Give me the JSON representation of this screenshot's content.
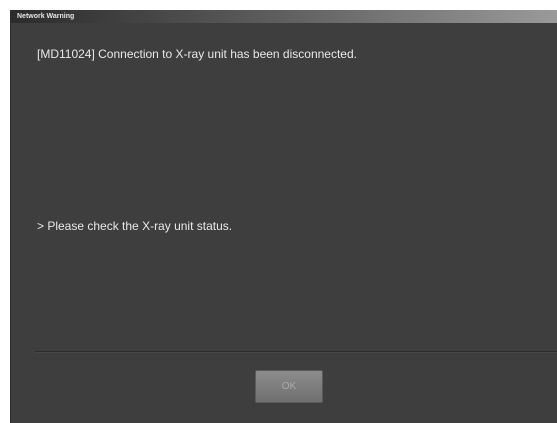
{
  "dialog": {
    "title": "Network Warning",
    "message": "[MD11024] Connection to X-ray unit has been disconnected.",
    "detail": "> Please check the X-ray unit status.",
    "ok_label": "OK"
  }
}
